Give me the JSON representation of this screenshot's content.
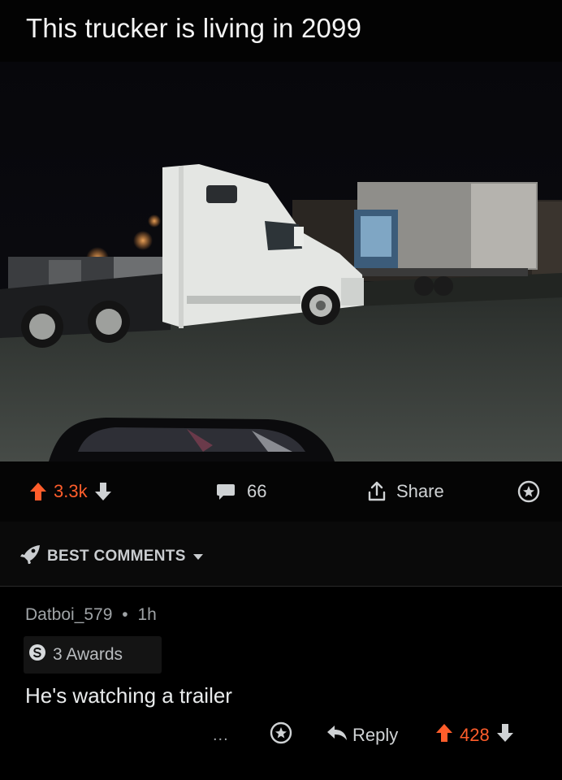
{
  "post": {
    "title": "This trucker is living in 2099"
  },
  "actions": {
    "upvotes": "3.3k",
    "comments": "66",
    "share_label": "Share"
  },
  "sort": {
    "label": "BEST COMMENTS"
  },
  "comment": {
    "author": "Datboi_579",
    "separator": "•",
    "age": "1h",
    "awards": "3 Awards",
    "body": "He's watching a trailer",
    "more": "...",
    "reply_label": "Reply",
    "score": "428"
  },
  "colors": {
    "upvote_accent": "#ff5d2b",
    "background": "#000000"
  }
}
